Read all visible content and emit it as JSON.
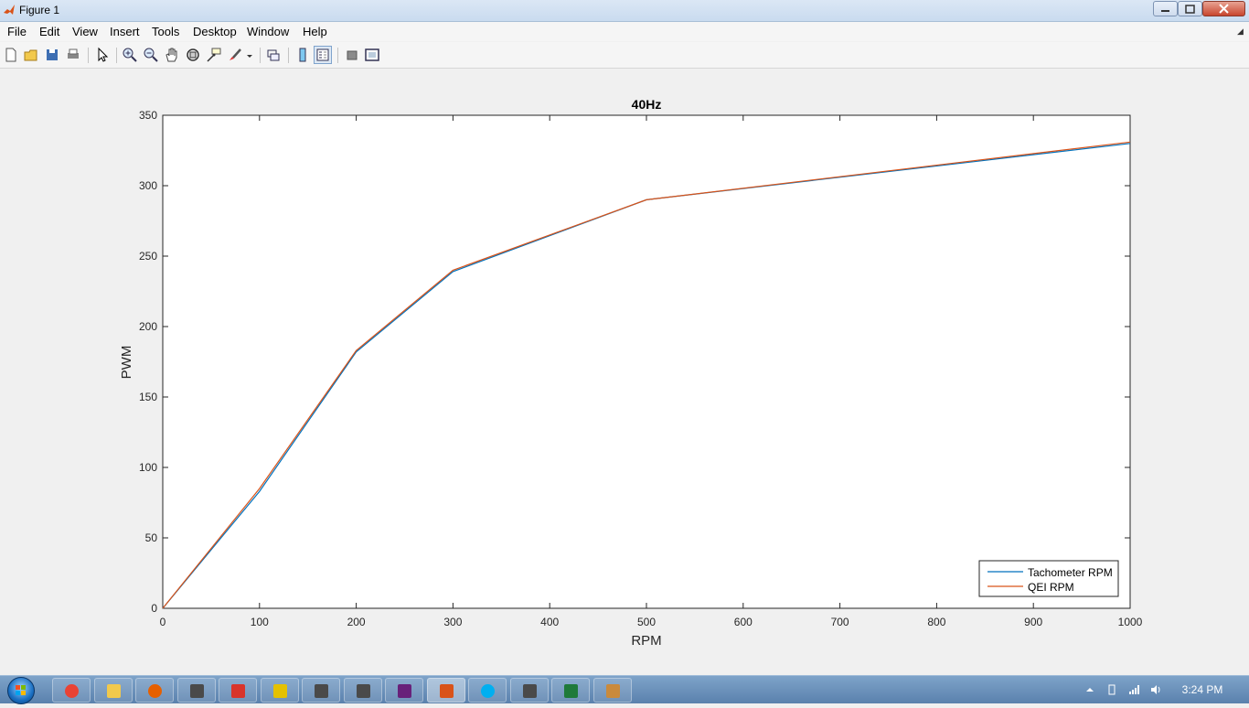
{
  "window": {
    "title": "Figure 1"
  },
  "menu": {
    "file": "File",
    "edit": "Edit",
    "view": "View",
    "insert": "Insert",
    "tools": "Tools",
    "desktop": "Desktop",
    "window": "Window",
    "help": "Help"
  },
  "toolbar_icons": [
    "new-figure-icon",
    "open-file-icon",
    "save-icon",
    "print-icon",
    "edit-plot-arrow-icon",
    "zoom-in-icon",
    "zoom-out-icon",
    "pan-hand-icon",
    "rotate-3d-icon",
    "data-cursor-icon",
    "brush-icon",
    "link-plot-icon",
    "insert-colorbar-icon",
    "insert-legend-icon",
    "hide-plot-tools-icon",
    "show-plot-tools-icon"
  ],
  "colors": {
    "series1": "#0072bd",
    "series2": "#d95319",
    "titlebar": "#c9dbef",
    "taskbar": "#5a81ad"
  },
  "chart_data": {
    "type": "line",
    "title": "40Hz",
    "xlabel": "RPM",
    "ylabel": "PWM",
    "xlim": [
      0,
      1000
    ],
    "ylim": [
      0,
      350
    ],
    "xticks": [
      0,
      100,
      200,
      300,
      400,
      500,
      600,
      700,
      800,
      900,
      1000
    ],
    "yticks": [
      0,
      50,
      100,
      150,
      200,
      250,
      300,
      350
    ],
    "grid": false,
    "legend_position": "bottom-right",
    "series": [
      {
        "name": "Tachometer RPM",
        "color": "#0072bd",
        "x": [
          0,
          100,
          200,
          300,
          500,
          1000
        ],
        "y": [
          0,
          83,
          182,
          239,
          290,
          330
        ]
      },
      {
        "name": "QEI RPM",
        "color": "#d95319",
        "x": [
          0,
          100,
          200,
          300,
          500,
          1000
        ],
        "y": [
          0,
          85,
          183,
          240,
          290,
          331
        ]
      }
    ]
  },
  "taskbar": {
    "apps": [
      "chrome-icon",
      "file-explorer-icon",
      "firefox-icon",
      "app-icon",
      "acrobat-icon",
      "tool-icon",
      "app-icon",
      "app-icon",
      "visual-studio-icon",
      "matlab-icon",
      "skype-icon",
      "app-icon",
      "excel-icon",
      "paint-icon"
    ],
    "clock": "3:24 PM"
  }
}
